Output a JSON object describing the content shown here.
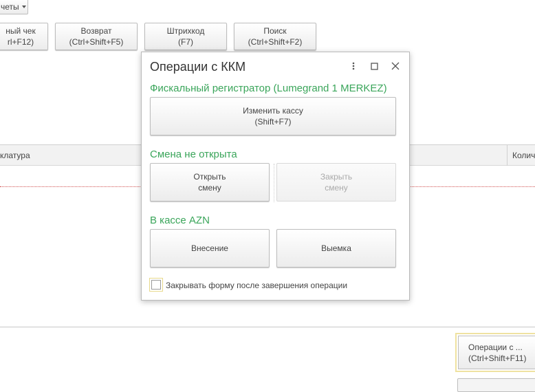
{
  "toolbar": {
    "reports_label": "четы",
    "buttons": [
      {
        "line1": "ный чек",
        "line2": "rl+F12)"
      },
      {
        "line1": "Возврат",
        "line2": "(Ctrl+Shift+F5)"
      },
      {
        "line1": "Штрихкод",
        "line2": "(F7)"
      },
      {
        "line1": "Поиск",
        "line2": "(Ctrl+Shift+F2)"
      }
    ]
  },
  "table": {
    "columns": [
      "клатура",
      "Колич"
    ]
  },
  "bottom": {
    "operations_line1": "Операции с ...",
    "operations_line2": "(Ctrl+Shift+F11)"
  },
  "dialog": {
    "title": "Операции с ККМ",
    "fiscal_title": "Фискальный регистратор (Lumegrand 1 MERKEZ)",
    "change_kkm_line1": "Изменить кассу",
    "change_kkm_line2": "(Shift+F7)",
    "shift_title": "Смена не открыта",
    "open_shift_line1": "Открыть",
    "open_shift_line2": "смену",
    "close_shift_line1": "Закрыть",
    "close_shift_line2": "смену",
    "cash_title": "В кассе  AZN",
    "deposit_label": "Внесение",
    "withdraw_label": "Выемка",
    "close_form_label": "Закрывать форму после завершения операции",
    "close_form_checked": false
  },
  "colors": {
    "section_title": "#3aa55a",
    "disabled_text": "#aaaaaa",
    "focus_border": "#efe2a0"
  },
  "icons": [
    "more-vertical-icon",
    "maximize-icon",
    "close-icon",
    "caret-down-icon"
  ]
}
